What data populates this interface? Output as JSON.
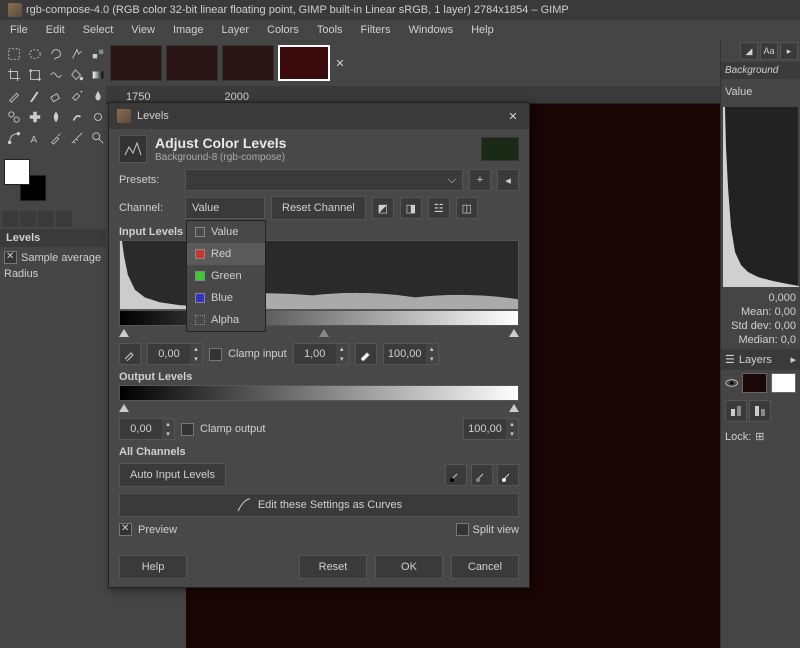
{
  "window_title": "rgb-compose-4.0 (RGB color 32-bit linear floating point, GIMP built-in Linear sRGB, 1 layer) 2784x1854 – GIMP",
  "menubar": [
    "File",
    "Edit",
    "Select",
    "View",
    "Image",
    "Layer",
    "Colors",
    "Tools",
    "Filters",
    "Windows",
    "Help"
  ],
  "ruler_ticks": [
    "1750",
    "2000"
  ],
  "left_dock": {
    "levels_label": "Levels",
    "sample_avg": "Sample average",
    "radius": "Radius"
  },
  "right": {
    "bg_label": "Background",
    "value_label": "Value",
    "stat_value": "0,000",
    "mean": "Mean:",
    "mean_v": "0,00",
    "std": "Std dev:",
    "std_v": "0,00",
    "median": "Median:",
    "median_v": "0,0",
    "layers_label": "Layers",
    "lock_label": "Lock:"
  },
  "dialog": {
    "title": "Levels",
    "header": "Adjust Color Levels",
    "subheader": "Background-8 (rgb-compose)",
    "presets_label": "Presets:",
    "channel_label": "Channel:",
    "channel_value": "Value",
    "reset_channel": "Reset Channel",
    "dropdown": [
      "Value",
      "Red",
      "Green",
      "Blue",
      "Alpha"
    ],
    "input_levels": "Input Levels",
    "low_in": "0,00",
    "gamma": "1,00",
    "high_in": "100,00",
    "clamp_input": "Clamp input",
    "output_levels": "Output Levels",
    "low_out": "0,00",
    "high_out": "100,00",
    "clamp_output": "Clamp output",
    "all_channels": "All Channels",
    "auto_levels": "Auto Input Levels",
    "edit_curves": "Edit these Settings as Curves",
    "preview": "Preview",
    "split_view": "Split view",
    "help": "Help",
    "reset": "Reset",
    "ok": "OK",
    "cancel": "Cancel"
  }
}
